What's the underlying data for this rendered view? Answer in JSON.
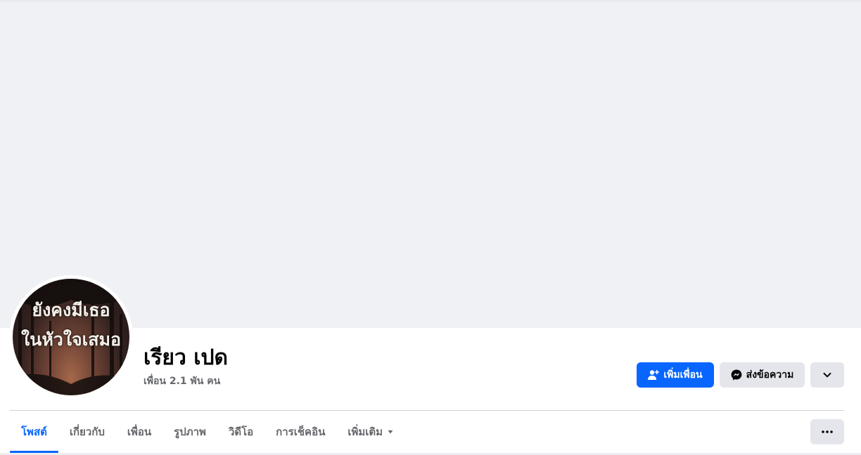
{
  "profile": {
    "name": "เรียว เปด",
    "friend_count": "เพื่อน 2.1 พัน คน",
    "avatar_text_line1": "ยังคงมีเธอ",
    "avatar_text_line2": "ในหัวใจเสมอ"
  },
  "actions": {
    "add_friend_label": "เพิ่มเพื่อน",
    "message_label": "ส่งข้อความ",
    "add_friend_icon": "user-plus-icon",
    "message_icon": "messenger-icon",
    "dropdown_icon": "chevron-down-icon"
  },
  "tabs": [
    {
      "label": "โพสต์",
      "active": true
    },
    {
      "label": "เกี่ยวกับ",
      "active": false
    },
    {
      "label": "เพื่อน",
      "active": false
    },
    {
      "label": "รูปภาพ",
      "active": false
    },
    {
      "label": "วิดีโอ",
      "active": false
    },
    {
      "label": "การเช็คอิน",
      "active": false
    },
    {
      "label": "เพิ่มเติม",
      "active": false
    }
  ],
  "colors": {
    "accent": "#0866ff",
    "secondary_button": "#e4e6eb",
    "cover_background": "#f0f1f5",
    "muted_text": "#65676b"
  }
}
